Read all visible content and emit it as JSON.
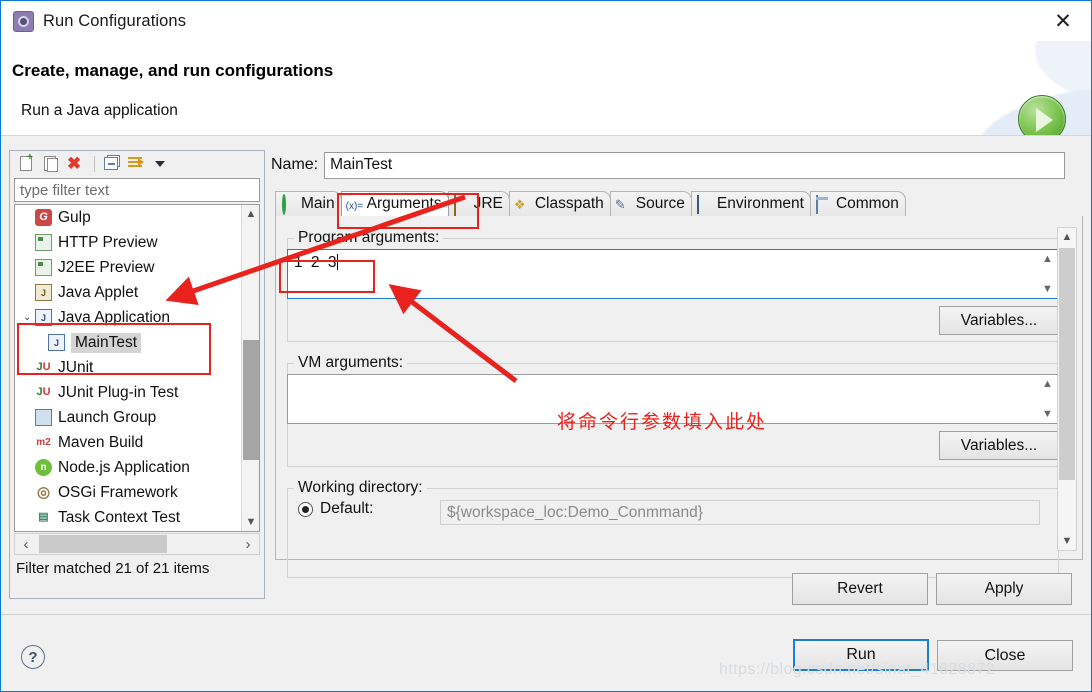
{
  "window": {
    "title": "Run Configurations",
    "title_icon": "run-config-icon",
    "close_label": "✕"
  },
  "header": {
    "title": "Create, manage, and run configurations",
    "subtitle": "Run a Java application",
    "badge_icon": "green-run-play-icon"
  },
  "left_panel": {
    "toolbar": [
      {
        "name": "new-configuration",
        "icon": "new-document-icon"
      },
      {
        "name": "duplicate-configuration",
        "icon": "duplicate-document-icon"
      },
      {
        "name": "delete-configuration",
        "icon": "red-x-delete-icon"
      },
      {
        "name": "collapse-all",
        "icon": "collapse-all-icon"
      },
      {
        "name": "filter-configurations",
        "icon": "filter-icon"
      },
      {
        "name": "view-menu",
        "icon": "chevron-down-icon"
      }
    ],
    "filter": {
      "placeholder": "type filter text",
      "value": ""
    },
    "tree": [
      {
        "label": "Gulp",
        "icon": "gulp-icon",
        "indent": 0,
        "twisty": "",
        "selected": false
      },
      {
        "label": "HTTP Preview",
        "icon": "server-icon",
        "indent": 0,
        "twisty": "",
        "selected": false
      },
      {
        "label": "J2EE Preview",
        "icon": "server-icon",
        "indent": 0,
        "twisty": "",
        "selected": false
      },
      {
        "label": "Java Applet",
        "icon": "java-applet-icon",
        "indent": 0,
        "twisty": "",
        "selected": false
      },
      {
        "label": "Java Application",
        "icon": "java-application-icon",
        "indent": 0,
        "twisty": "⌄",
        "selected": false
      },
      {
        "label": "MainTest",
        "icon": "java-application-icon",
        "indent": 1,
        "twisty": "",
        "selected": true
      },
      {
        "label": "JUnit",
        "icon": "junit-icon",
        "indent": 0,
        "twisty": "",
        "selected": false
      },
      {
        "label": "JUnit Plug-in Test",
        "icon": "junit-plugin-icon",
        "indent": 0,
        "twisty": "",
        "selected": false
      },
      {
        "label": "Launch Group",
        "icon": "launch-group-icon",
        "indent": 0,
        "twisty": "",
        "selected": false
      },
      {
        "label": "Maven Build",
        "icon": "maven-icon",
        "indent": 0,
        "twisty": "",
        "selected": false
      },
      {
        "label": "Node.js Application",
        "icon": "nodejs-icon",
        "indent": 0,
        "twisty": "",
        "selected": false
      },
      {
        "label": "OSGi Framework",
        "icon": "osgi-icon",
        "indent": 0,
        "twisty": "",
        "selected": false
      },
      {
        "label": "Task Context Test",
        "icon": "task-context-icon",
        "indent": 0,
        "twisty": "",
        "selected": false
      }
    ],
    "status": "Filter matched 21 of 21 items"
  },
  "right_panel": {
    "name_label": "Name:",
    "name_value": "MainTest",
    "tabs": [
      {
        "label": "Main",
        "icon": "main-tab-icon",
        "active": false
      },
      {
        "label": "Arguments",
        "icon": "arguments-tab-icon",
        "active": true
      },
      {
        "label": "JRE",
        "icon": "jre-tab-icon",
        "active": false
      },
      {
        "label": "Classpath",
        "icon": "classpath-tab-icon",
        "active": false
      },
      {
        "label": "Source",
        "icon": "source-tab-icon",
        "active": false
      },
      {
        "label": "Environment",
        "icon": "environment-tab-icon",
        "active": false
      },
      {
        "label": "Common",
        "icon": "common-tab-icon",
        "active": false
      }
    ],
    "program_arguments": {
      "label": "Program arguments:",
      "value": "1  2  3",
      "variables_button": "Variables..."
    },
    "vm_arguments": {
      "label": "VM arguments:",
      "value": "",
      "variables_button": "Variables..."
    },
    "working_directory": {
      "label": "Working directory:",
      "default_radio_label": "Default:",
      "default_value": "${workspace_loc:Demo_Conmmand}"
    },
    "revert_button": "Revert",
    "apply_button": "Apply"
  },
  "footer": {
    "help_icon": "help-question-icon",
    "run_button": "Run",
    "close_button": "Close",
    "watermark": "https://blog.csdn.net/sinat_41628872"
  },
  "annotations": {
    "chinese_note": "将命令行参数填入此处",
    "color": "#e8221c"
  }
}
